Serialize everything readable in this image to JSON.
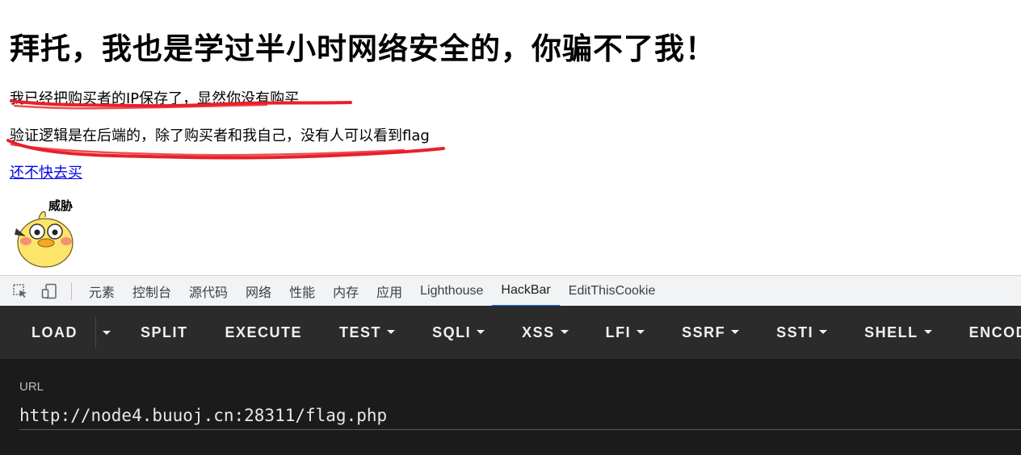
{
  "page": {
    "heading": "拜托，我也是学过半小时网络安全的，你骗不了我！",
    "line1": "我已经把购买者的IP保存了，显然你没有购买",
    "line2": "验证逻辑是在后端的，除了购买者和我自己，没有人可以看到flag",
    "buy_link": "还不快去买",
    "sticker_caption": "威胁",
    "annotation_color": "#e8202a"
  },
  "devtools": {
    "tabs": [
      "元素",
      "控制台",
      "源代码",
      "网络",
      "性能",
      "内存",
      "应用",
      "Lighthouse",
      "HackBar",
      "EditThisCookie"
    ],
    "active_tab": "HackBar",
    "accent": "#1a73e8"
  },
  "hackbar": {
    "buttons": {
      "load": "LOAD",
      "split": "SPLIT",
      "execute": "EXECUTE",
      "test": "TEST",
      "sqli": "SQLI",
      "xss": "XSS",
      "lfi": "LFI",
      "ssrf": "SSRF",
      "ssti": "SSTI",
      "shell": "SHELL",
      "encode": "ENCODING"
    },
    "url_label": "URL",
    "url_value": "http://node4.buuoj.cn:28311/flag.php"
  }
}
